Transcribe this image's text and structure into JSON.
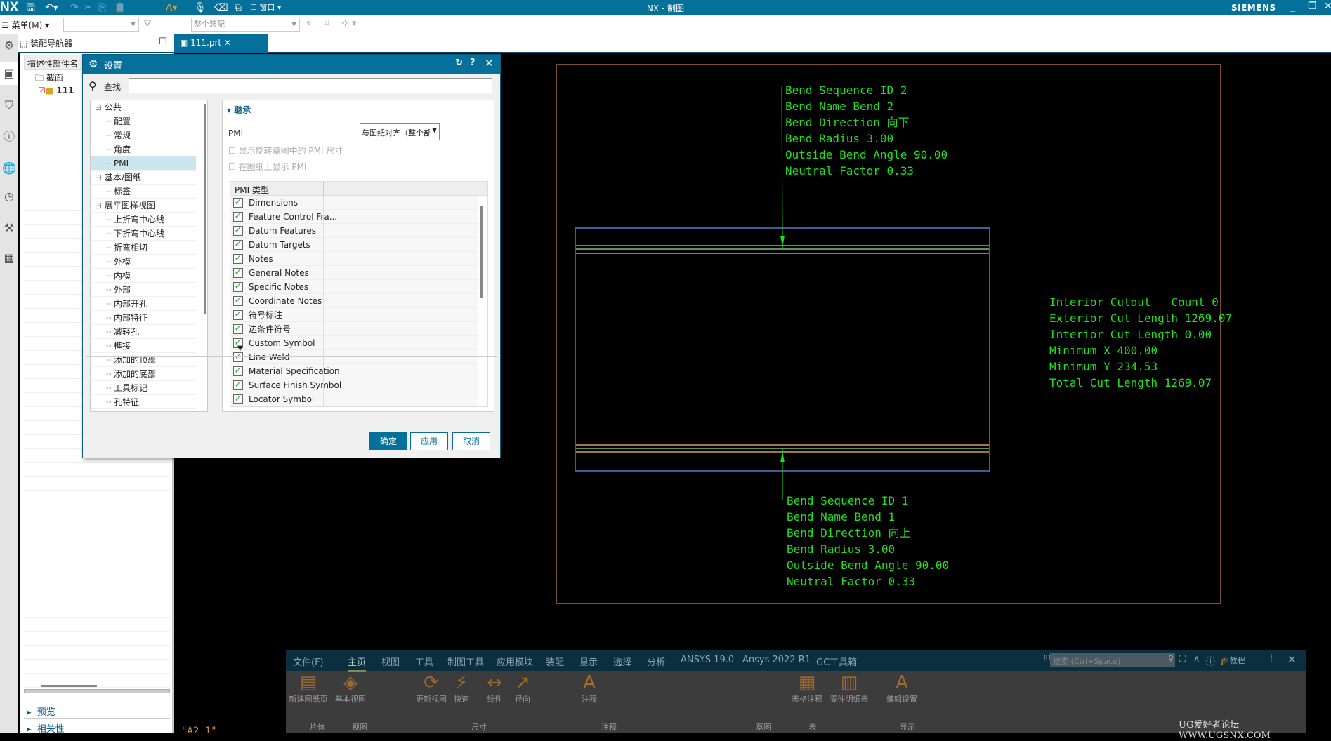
{
  "titlebar": {
    "logo": "NX",
    "title": "NX - 制图",
    "brand": "SIEMENS",
    "window_menu": "窗口"
  },
  "toolbar": {
    "menu_label": "菜单(M)",
    "assembly_scope": "整个装配"
  },
  "navigator": {
    "title": "装配导航器",
    "column_header": "描述性部件名",
    "items": [
      {
        "label": "截面",
        "icon": "folder-icon"
      },
      {
        "label": "111",
        "icon": "part-icon",
        "checked": true
      }
    ],
    "panels": [
      "预览",
      "相关性"
    ]
  },
  "file_tab": {
    "label": "111.prt"
  },
  "dialog": {
    "title": "设置",
    "search_label": "查找",
    "search_value": "",
    "tree": [
      {
        "label": "公共",
        "level": 0
      },
      {
        "label": "配置",
        "level": 1
      },
      {
        "label": "常规",
        "level": 1
      },
      {
        "label": "角度",
        "level": 1
      },
      {
        "label": "PMI",
        "level": 1,
        "selected": true
      },
      {
        "label": "基本/图纸",
        "level": 0
      },
      {
        "label": "标签",
        "level": 1
      },
      {
        "label": "展平图样视图",
        "level": 0
      },
      {
        "label": "上折弯中心线",
        "level": 1
      },
      {
        "label": "下折弯中心线",
        "level": 1
      },
      {
        "label": "折弯相切",
        "level": 1
      },
      {
        "label": "外模",
        "level": 1
      },
      {
        "label": "内模",
        "level": 1
      },
      {
        "label": "外部",
        "level": 1
      },
      {
        "label": "内部开孔",
        "level": 1
      },
      {
        "label": "内部特征",
        "level": 1
      },
      {
        "label": "减轻孔",
        "level": 1
      },
      {
        "label": "榫接",
        "level": 1
      },
      {
        "label": "添加的顶部",
        "level": 1
      },
      {
        "label": "添加的底部",
        "level": 1
      },
      {
        "label": "工具标记",
        "level": 1
      },
      {
        "label": "孔特征",
        "level": 1
      }
    ],
    "section_title": "继承",
    "pmi_label": "PMI",
    "pmi_value": "与图纸对齐（整个部件",
    "opt_rotate": "显示旋转草图中的 PMI 尺寸",
    "opt_show": "在图纸上显示 PMI",
    "table_header": "PMI 类型",
    "pmi_types": [
      "Dimensions",
      "Feature Control Fra...",
      "Datum Features",
      "Datum Targets",
      "Notes",
      "General Notes",
      "Specific Notes",
      "Coordinate Notes",
      "符号标注",
      "边条件符号",
      "Custom Symbol",
      "Line Weld",
      "Material Specification",
      "Surface Finish Symbol",
      "Locator Symbol"
    ],
    "ok": "确定",
    "apply": "应用",
    "cancel": "取消"
  },
  "drawing": {
    "top_note": [
      "Bend Sequence ID 2",
      "Bend Name Bend 2",
      "Bend Direction 向下",
      "Bend Radius 3.00",
      "Outside Bend Angle 90.00",
      "Neutral Factor 0.33"
    ],
    "right_note": [
      "Interior Cutout   Count 0",
      "Exterior Cut Length 1269.07",
      "Interior Cut Length 0.00",
      "Minimum X 400.00",
      "Minimum Y 234.53",
      "Total Cut Length 1269.07"
    ],
    "bottom_note": [
      "Bend Sequence ID 1",
      "Bend Name Bend 1",
      "Bend Direction 向上",
      "Bend Radius 3.00",
      "Outside Bend Angle 90.00",
      "Neutral Factor 0.33"
    ],
    "sheet_label": "\"A2_1\"",
    "colors": {
      "border": "#c8864a",
      "outline": "#5a78c8",
      "bend": "#d4a050",
      "bend_center": "#7cc47c",
      "annotation": "#1fe01f"
    }
  },
  "ribbon": {
    "tabs": [
      "文件(F)",
      "主页",
      "视图",
      "工具",
      "制图工具",
      "应用模块",
      "装配",
      "显示",
      "选择",
      "分析",
      "ANSYS 19.0",
      "Ansys 2022 R1",
      "GC工具箱"
    ],
    "active_tab": "主页",
    "search_placeholder": "搜索 (Ctrl+Space)",
    "tutorial": "教程",
    "buttons": [
      "新建图纸页",
      "基本视图",
      "更新视图",
      "快速",
      "线性",
      "径向",
      "注释",
      "表格注释",
      "零件明细表",
      "编辑设置"
    ],
    "groups": [
      "片体",
      "视图",
      "尺寸",
      "注释",
      "草图",
      "表",
      "显示"
    ]
  },
  "watermark": "UG爱好者论坛 WWW.UGSNX.COM"
}
